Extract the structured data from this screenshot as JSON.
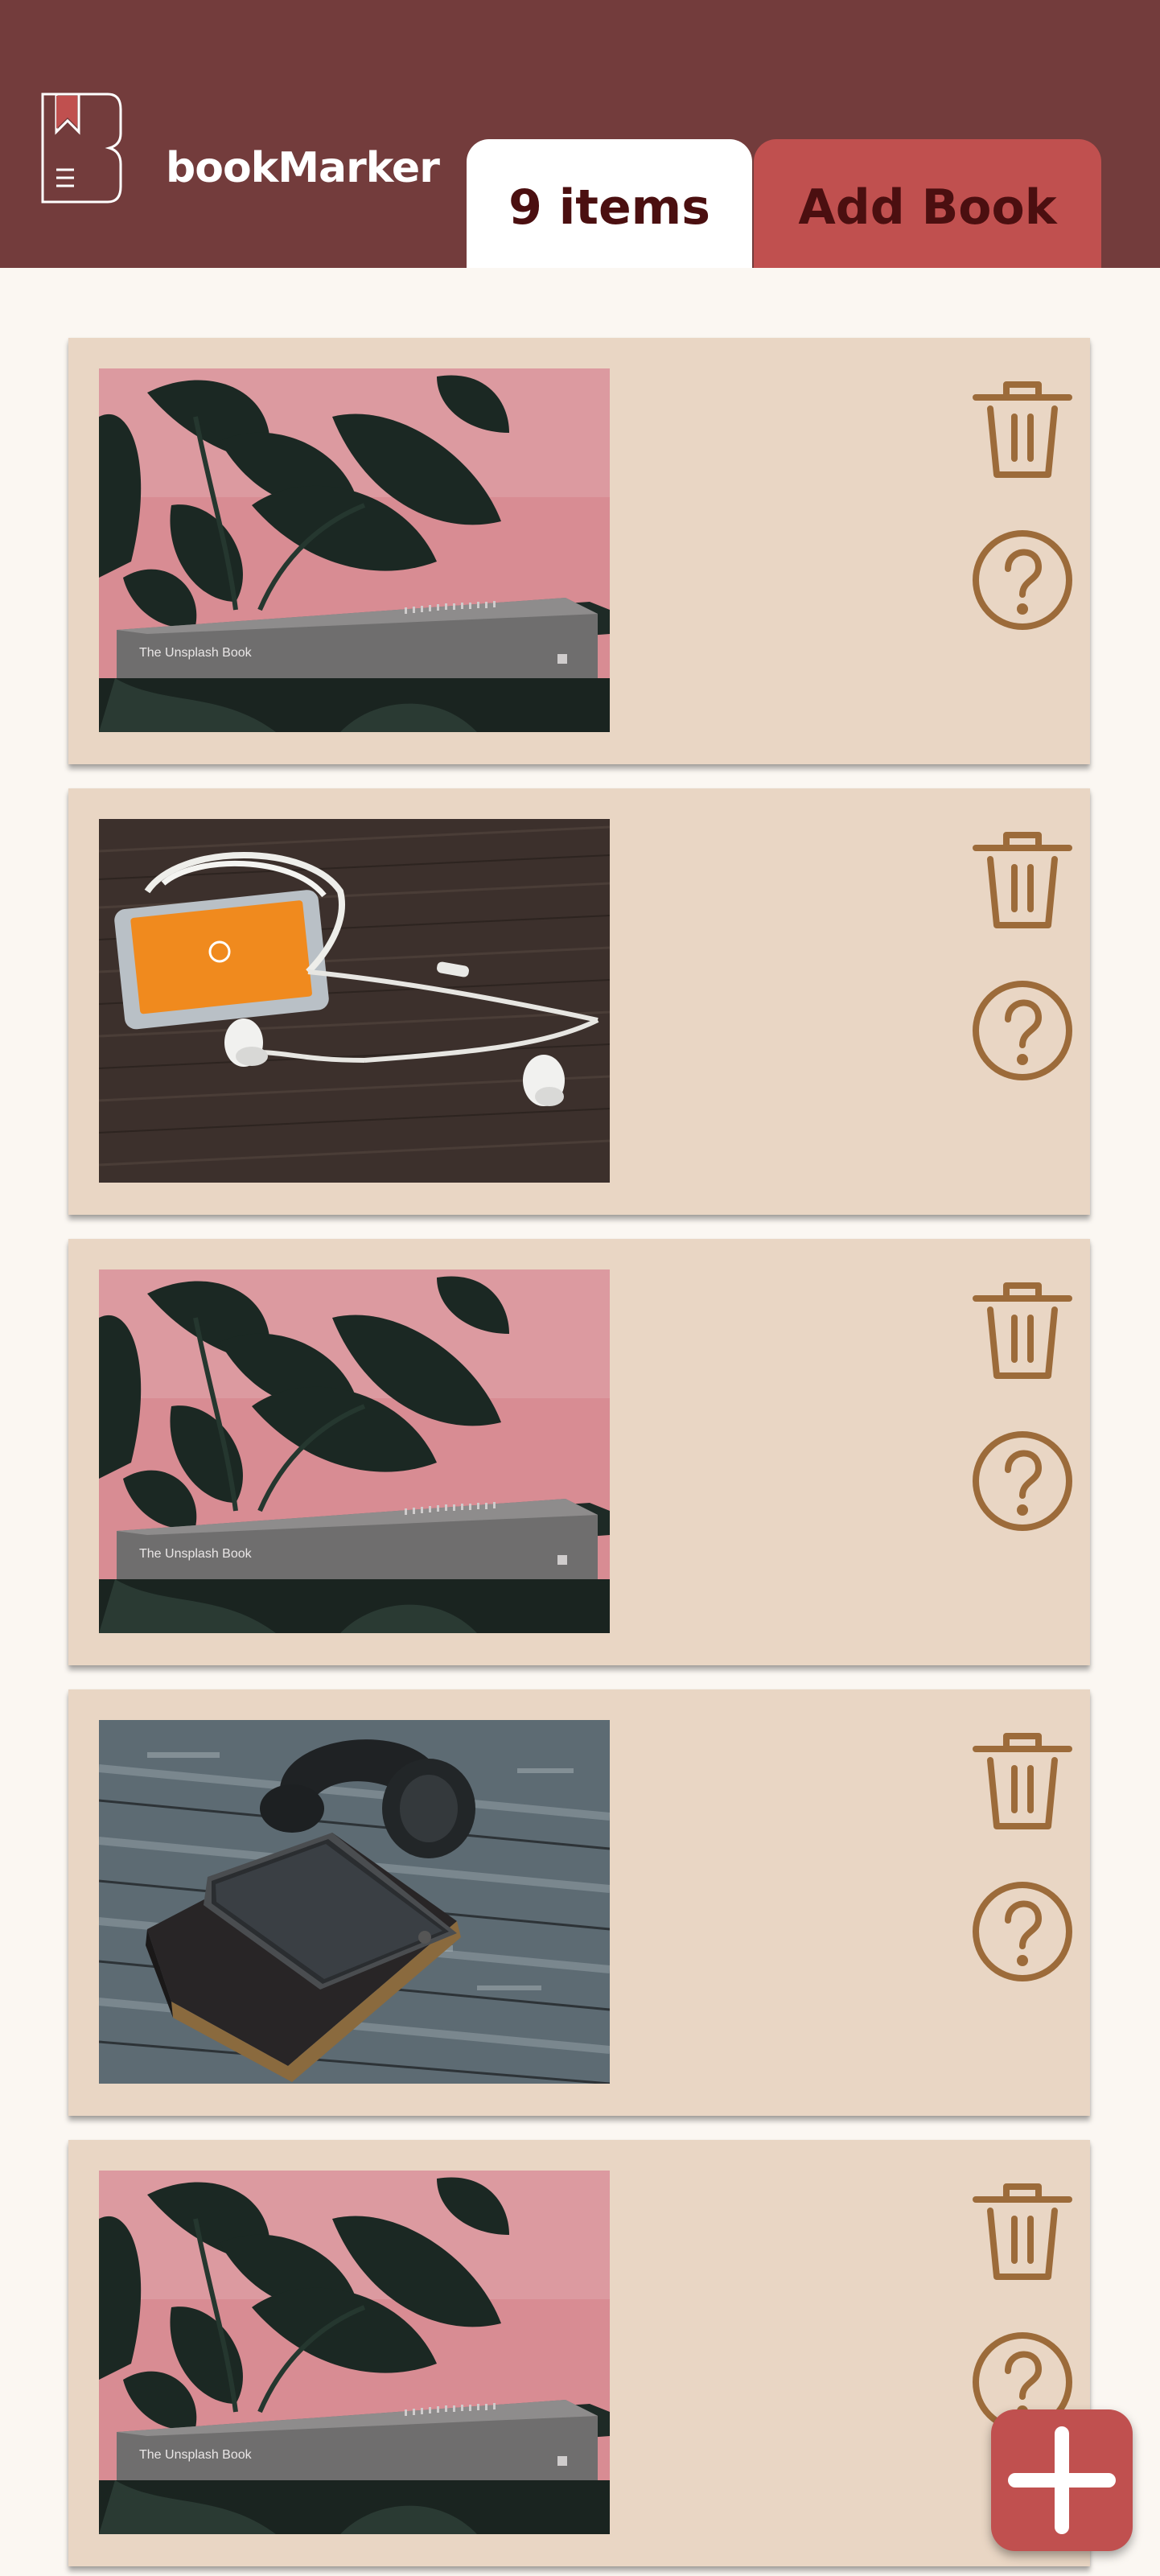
{
  "app": {
    "brand": "bookMarker"
  },
  "tabs": {
    "items_label": "9 items",
    "add_label": "Add Book"
  },
  "colors": {
    "header": "#733c3c",
    "accent": "#c0504f",
    "card": "#e9d6c4",
    "icon": "#9c6b3a",
    "tab_text": "#4b0f10"
  },
  "bookmarks": [
    {
      "image": "plant-book-photo",
      "image_text": "The Unsplash Book"
    },
    {
      "image": "phone-earphones-photo",
      "image_text": ""
    },
    {
      "image": "plant-book-photo",
      "image_text": "The Unsplash Book"
    },
    {
      "image": "phone-headphones-notebook-photo",
      "image_text": ""
    },
    {
      "image": "plant-book-photo",
      "image_text": "The Unsplash Book"
    }
  ],
  "icons": {
    "delete": "trash-icon",
    "details": "question-circle-icon",
    "add": "plus-icon"
  }
}
